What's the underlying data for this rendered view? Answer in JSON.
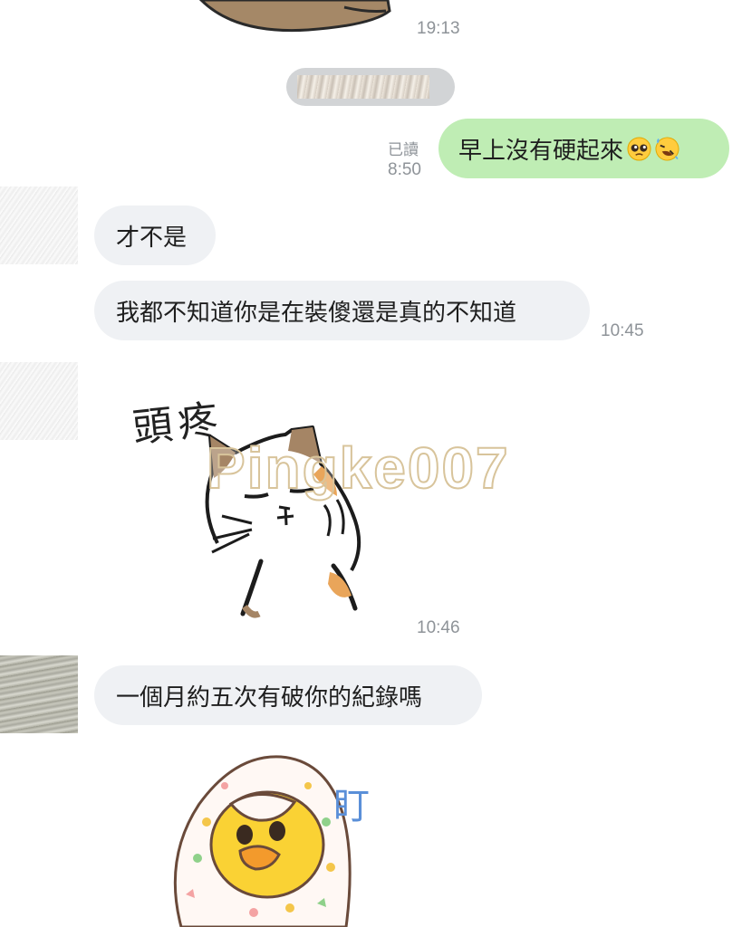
{
  "messages": {
    "top_sticker_time": "19:13",
    "out_message": {
      "text": "早上沒有硬起來",
      "read_label": "已讀",
      "time": "8:50"
    },
    "in_message_1": {
      "text": "才不是"
    },
    "in_message_2": {
      "text": "我都不知道你是在裝傻還是真的不知道",
      "time": "10:45"
    },
    "cat_sticker": {
      "caption": "頭疼",
      "time": "10:46"
    },
    "in_message_3": {
      "text": "一個月約五次有破你的紀錄嗎"
    },
    "chick_sticker": {
      "caption": "盯"
    }
  },
  "watermark": "Pingke007",
  "icons": {
    "emoji_1": "pleading-face-emoji",
    "emoji_2": "rolling-on-floor-laughing-emoji"
  },
  "colors": {
    "outgoing_bubble": "#bfedb4",
    "incoming_bubble": "#eff1f4",
    "timestamp": "#8e9398"
  }
}
